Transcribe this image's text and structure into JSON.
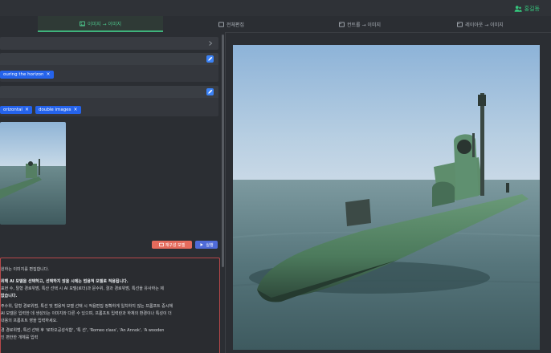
{
  "user": {
    "name": "홍길동",
    "icon": "user-icon",
    "color": "#35c77d"
  },
  "tabs": [
    {
      "label": "이미지 → 이미지",
      "icon": "image-icon",
      "active": true
    },
    {
      "label": "전체편집",
      "icon": "edit-icon",
      "active": false
    },
    {
      "label": "컨트롤 → 이미지",
      "icon": "image-icon",
      "active": false
    },
    {
      "label": "레이아웃 → 이미지",
      "icon": "image-icon",
      "active": false
    }
  ],
  "fields": {
    "chips_a": [
      {
        "label": "ouring the horizon"
      }
    ],
    "chips_b": [
      {
        "label": "orizontal"
      },
      {
        "label": "double images"
      }
    ]
  },
  "buttons": {
    "reset": "재구성 모델",
    "run": "실행"
  },
  "log": {
    "lines": [
      "   원하는 이미지를 편집합니다.",
      "   위해 AI 모델을 선택하고, 선택하지 않을 시에는 범용적 모델로 적용됩니다.",
      "   표현 수, 탈형 경로위범, 특산 선택 시 AI 모델(로더)과 문수위, 결과 경로위범, 특선을 유사하는 제",
      "   없습니다.",
      "   주수위, 탈형 경로위범, 특선 및 범용적 모델 선택 시 적용편집 정확하게 일치하지 않는 프롬프트 중시해",
      "   AI 모델은 입력한 데 생성되는 이미지와 다른 수 있으며, 프롬프트 입력란과 하체의 환경이나 특성이 더",
      "   내용의 프롬프트 영을 입력하세요.",
      "   경 경로위범, 특선 선택 후 '로마오공성식함', '특 선', 'Romeo class', 'An Annok', 'A wooden",
      "   인 편한한 개체를 입력"
    ],
    "bold_lines": [
      1,
      3
    ]
  }
}
